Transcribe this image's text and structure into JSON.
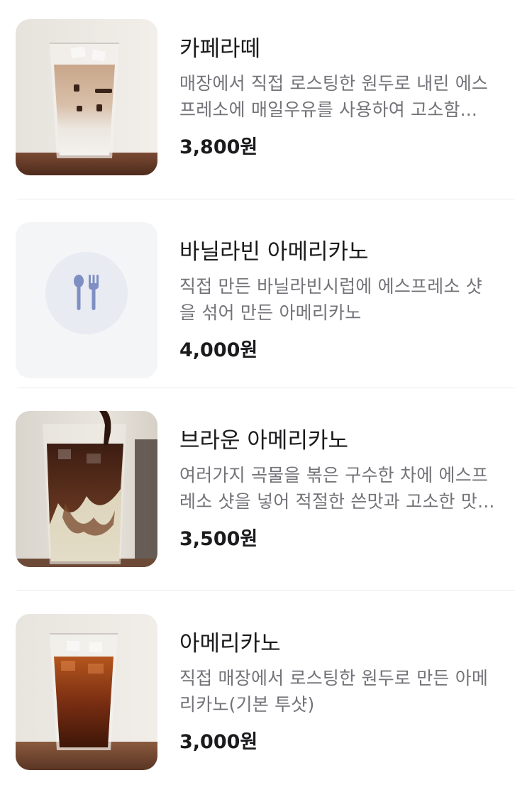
{
  "menu": {
    "items": [
      {
        "name": "카페라떼",
        "description_lines": [
          "매장에서 직접 로스팅한 원두로 내린 에스",
          "프레소에 매일우유를 사용하여 고소함..."
        ],
        "price": "3,800원",
        "image": "cafe-latte-photo"
      },
      {
        "name": "바닐라빈 아메리카노",
        "description_lines": [
          "직접 만든 바닐라빈시럽에 에스프레소 샷",
          "을 섞어 만든 아메리카노"
        ],
        "price": "4,000원",
        "image": "fork-spoon-icon"
      },
      {
        "name": "브라운 아메리카노",
        "description_lines": [
          "여러가지 곡물을 볶은 구수한 차에 에스프",
          "레소 샷을 넣어 적절한 쓴맛과 고소한 맛..."
        ],
        "price": "3,500원",
        "image": "brown-americano-photo"
      },
      {
        "name": "아메리카노",
        "description_lines": [
          "직접 매장에서 로스팅한 원두로 만든 아메",
          "리카노(기본 투샷)"
        ],
        "price": "3,000원",
        "image": "americano-photo"
      }
    ]
  }
}
